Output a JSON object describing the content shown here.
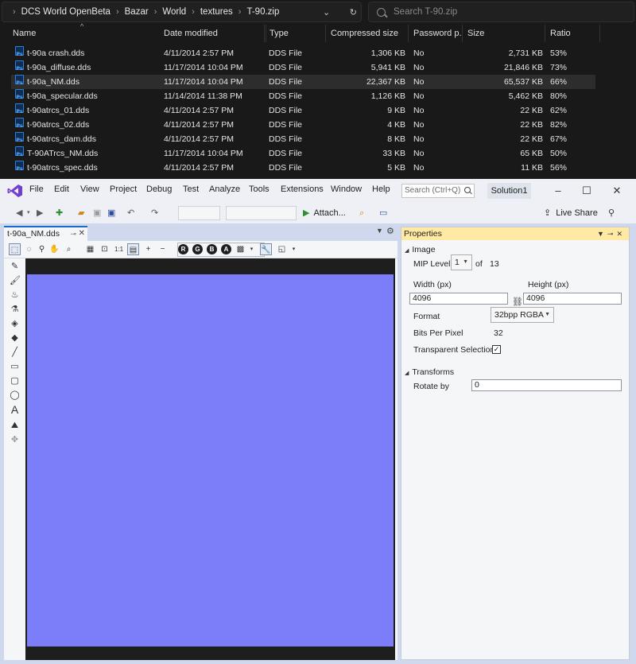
{
  "explorer": {
    "breadcrumbs": [
      "DCS World OpenBeta",
      "Bazar",
      "World",
      "textures",
      "T-90.zip"
    ],
    "search_placeholder": "Search T-90.zip",
    "columns": [
      "Name",
      "Date modified",
      "Type",
      "Compressed size",
      "Password p...",
      "Size",
      "Ratio"
    ],
    "files": [
      {
        "name": "t-90a crash.dds",
        "date": "4/11/2014 2:57 PM",
        "type": "DDS File",
        "compressed": "1,306 KB",
        "password": "No",
        "size": "2,731 KB",
        "ratio": "53%"
      },
      {
        "name": "t-90a_diffuse.dds",
        "date": "11/17/2014 10:04 PM",
        "type": "DDS File",
        "compressed": "5,941 KB",
        "password": "No",
        "size": "21,846 KB",
        "ratio": "73%"
      },
      {
        "name": "t-90a_NM.dds",
        "date": "11/17/2014 10:04 PM",
        "type": "DDS File",
        "compressed": "22,367 KB",
        "password": "No",
        "size": "65,537 KB",
        "ratio": "66%"
      },
      {
        "name": "t-90a_specular.dds",
        "date": "11/14/2014 11:38 PM",
        "type": "DDS File",
        "compressed": "1,126 KB",
        "password": "No",
        "size": "5,462 KB",
        "ratio": "80%"
      },
      {
        "name": "t-90atrcs_01.dds",
        "date": "4/11/2014 2:57 PM",
        "type": "DDS File",
        "compressed": "9 KB",
        "password": "No",
        "size": "22 KB",
        "ratio": "62%"
      },
      {
        "name": "t-90atrcs_02.dds",
        "date": "4/11/2014 2:57 PM",
        "type": "DDS File",
        "compressed": "4 KB",
        "password": "No",
        "size": "22 KB",
        "ratio": "82%"
      },
      {
        "name": "t-90atrcs_dam.dds",
        "date": "4/11/2014 2:57 PM",
        "type": "DDS File",
        "compressed": "8 KB",
        "password": "No",
        "size": "22 KB",
        "ratio": "67%"
      },
      {
        "name": "T-90ATrcs_NM.dds",
        "date": "11/17/2014 10:04 PM",
        "type": "DDS File",
        "compressed": "33 KB",
        "password": "No",
        "size": "65 KB",
        "ratio": "50%"
      },
      {
        "name": "t-90atrcs_spec.dds",
        "date": "4/11/2014 2:57 PM",
        "type": "DDS File",
        "compressed": "5 KB",
        "password": "No",
        "size": "11 KB",
        "ratio": "56%"
      }
    ],
    "file_icon_text": "Ps"
  },
  "vs": {
    "menu": [
      "File",
      "Edit",
      "View",
      "Project",
      "Debug",
      "Test",
      "Analyze",
      "Tools",
      "Extensions",
      "Window",
      "Help"
    ],
    "quick_search": "Search (Ctrl+Q)",
    "solution": "Solution1",
    "attach": "Attach...",
    "live_share": "Live Share",
    "doc_tab": "t-90a_NM.dds",
    "channels": [
      "R",
      "G",
      "B",
      "A"
    ],
    "accent": "#1b6ad4",
    "canvas_color": "#7b7ef8"
  },
  "properties": {
    "title": "Properties",
    "image_section": "Image",
    "mip_label": "MIP Level",
    "mip_value": "1",
    "of_label": "of",
    "mip_total": "13",
    "width_label": "Width (px)",
    "height_label": "Height (px)",
    "width_value": "4096",
    "height_value": "4096",
    "format_label": "Format",
    "format_value": "32bpp RGBA",
    "bpp_label": "Bits Per Pixel",
    "bpp_value": "32",
    "transparent_label": "Transparent Selection",
    "transforms_section": "Transforms",
    "rotate_label": "Rotate by",
    "rotate_value": "0"
  }
}
